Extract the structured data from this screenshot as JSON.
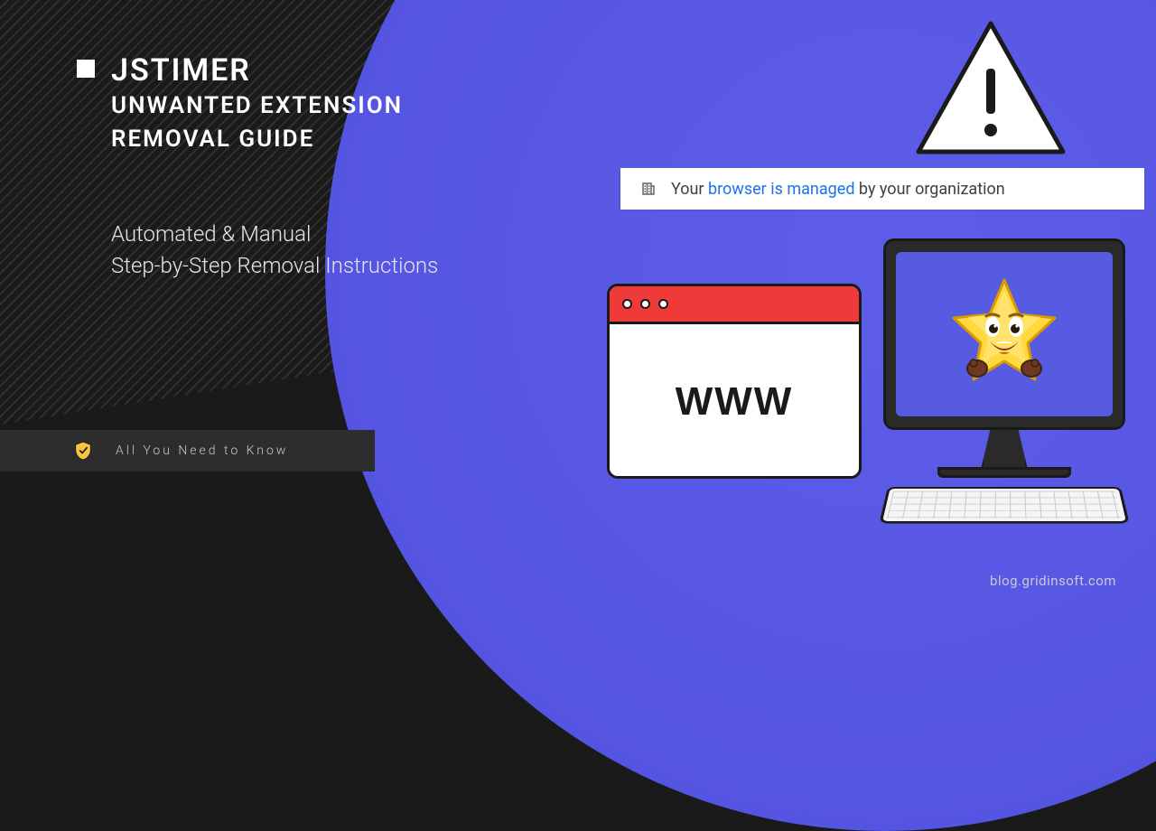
{
  "title": {
    "main": "JSTIMER",
    "sub_line1": "UNWANTED EXTENSION",
    "sub_line2": "REMOVAL GUIDE"
  },
  "subtitle": {
    "line1": "Automated & Manual",
    "line2": "Step-by-Step Removal Instructions"
  },
  "badge": {
    "text": "All You Need to Know"
  },
  "info_bar": {
    "prefix": "Your ",
    "link_text": "browser is managed",
    "suffix": " by your organization"
  },
  "browser": {
    "label": "WWW"
  },
  "credit": "blog.gridinsoft.com",
  "colors": {
    "purple": "#5151e0",
    "red": "#f03a3a",
    "star_yellow": "#ffd93d"
  }
}
